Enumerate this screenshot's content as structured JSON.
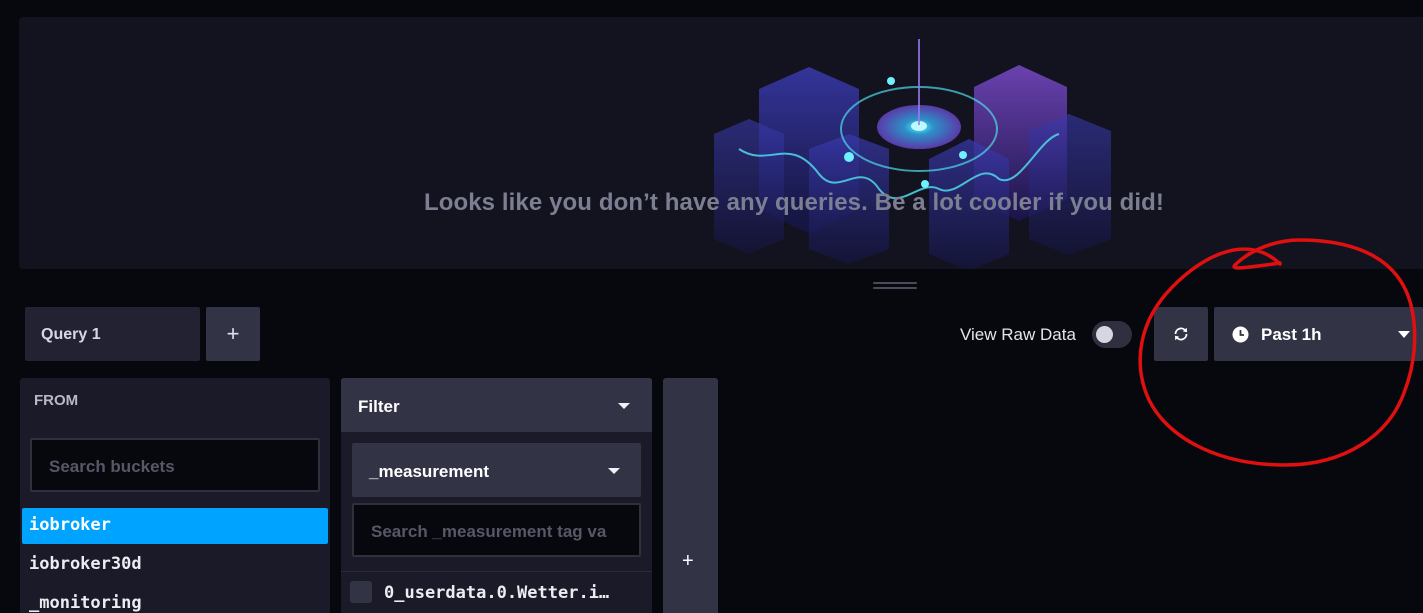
{
  "graph": {
    "empty_message": "Looks like you don’t have any queries. Be a lot cooler if you did!"
  },
  "toolbar": {
    "query_tab_label": "Query 1",
    "add_query_label": "+",
    "raw_data_label": "View Raw Data",
    "raw_data_enabled": false,
    "time_range_label": "Past 1h"
  },
  "from": {
    "title": "FROM",
    "search_placeholder": "Search buckets",
    "buckets": [
      "iobroker",
      "iobroker30d",
      "_monitoring"
    ],
    "selected_bucket": "iobroker"
  },
  "filter": {
    "header_label": "Filter",
    "key_label": "_measurement",
    "search_placeholder": "Search _measurement tag va",
    "values": [
      "0_userdata.0.Wetter.i…"
    ]
  },
  "add_function_label": "+",
  "colors": {
    "accent_selected": "#00a3ff",
    "panel_bg": "#1a1a28",
    "button_bg": "#333346",
    "annotation_red": "#e01010"
  }
}
